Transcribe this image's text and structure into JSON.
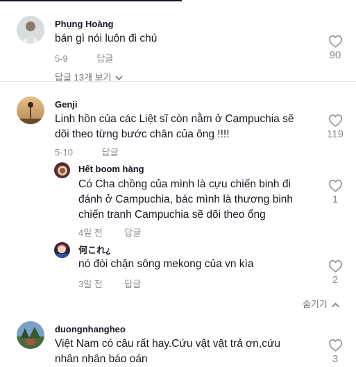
{
  "comments": [
    {
      "author": "Phụng Hoàng",
      "text": "bán gì nói luôn đi chú",
      "date": "5-9",
      "reply": "답글",
      "likes": "90",
      "view_replies": "답글 13개 보기",
      "avatar_icon": "avatar-photo-person"
    },
    {
      "author": "Genji",
      "text_line1": "Linh hồn của các Liệt sĩ còn nằm ở Campuchia sẽ",
      "text_line2": "dõi theo từng bước chân của ông !!!!",
      "date": "5-10",
      "reply": "답글",
      "likes": "119",
      "avatar_icon": "avatar-photo-sunset",
      "replies": [
        {
          "author": "Hết boom hàng",
          "text_line1": "Có Cha chồng của mình là cựu chiến binh đi",
          "text_line2": "đánh ở Campuchia, bác mình là thương binh",
          "text_line3": "chiến tranh Campuchia sẽ dõi theo ổng",
          "date": "4일 전",
          "reply": "답글",
          "likes": "1",
          "avatar_icon": "avatar-photo-food"
        },
        {
          "author": "何これ¿",
          "text": "nó đòi chặn sông mekong của vn kìa",
          "date": "3일 전",
          "reply": "답글",
          "likes": "2",
          "avatar_icon": "avatar-photo-anime"
        }
      ],
      "hide_label": "숨기기"
    },
    {
      "author": "duongnhangheo",
      "text_line1": "Việt Nam có câu rất hay.Cứu vật vật trả ơn,cứu",
      "text_line2": "nhân nhân báo oán",
      "likes": "3",
      "avatar_icon": "avatar-photo-landscape"
    }
  ],
  "icons": {
    "like": "heart-outline-icon",
    "expand": "chevron-down-icon",
    "collapse": "chevron-up-icon"
  },
  "colors": {
    "text": "#161823",
    "muted": "#8a8b91",
    "divider": "#e6e6e8"
  }
}
